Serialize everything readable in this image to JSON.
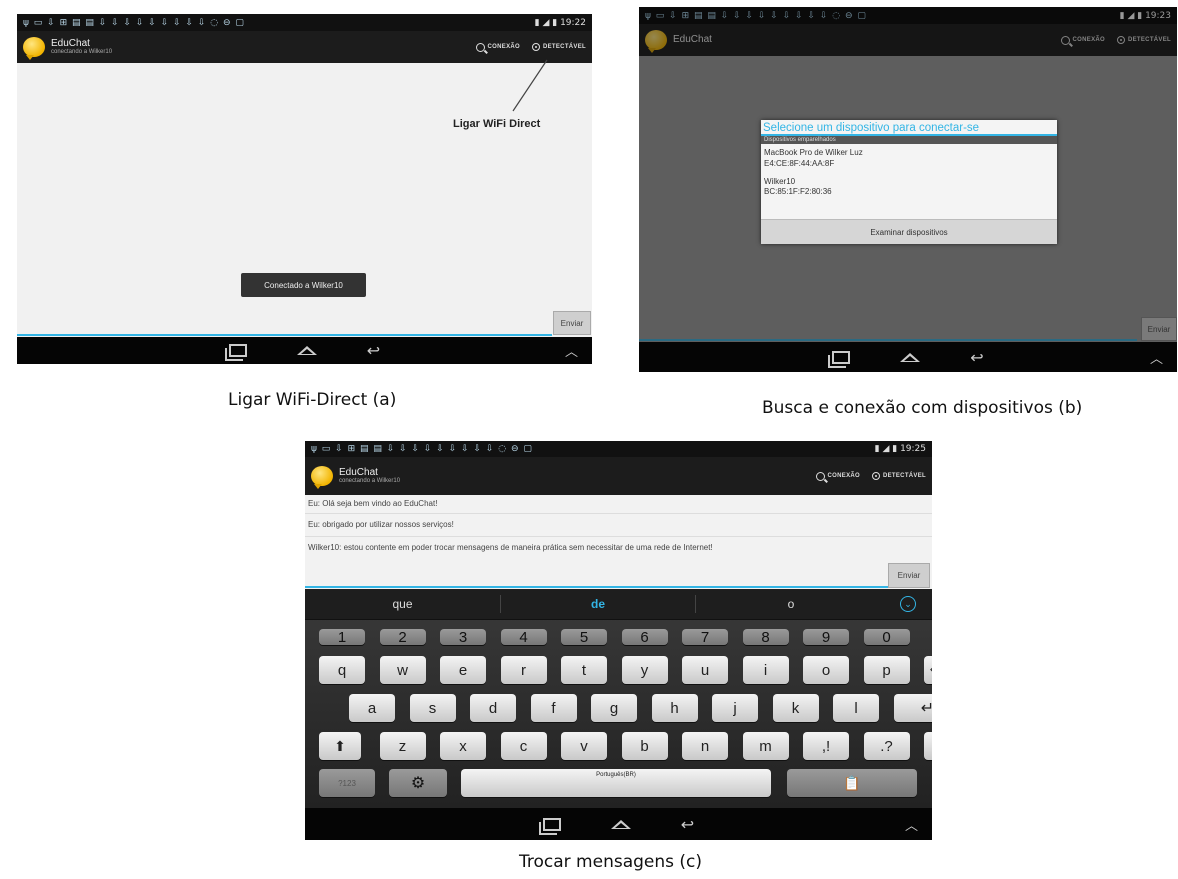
{
  "captions": {
    "a": "Ligar WiFi-Direct (a)",
    "b": "Busca e conexão com dispositivos (b)",
    "c": "Trocar mensagens (c)"
  },
  "colors": {
    "accent": "#33b5e5",
    "actionbar": "#1c1c1c",
    "navbar": "#050505"
  },
  "app": {
    "title": "EduChat",
    "subtitle": "conectando a Wilker10",
    "actions": {
      "connect": "CONEXÃO",
      "discoverable": "DETECTÁVEL"
    },
    "send_label": "Enviar"
  },
  "screen_a": {
    "status_time": "19:22",
    "annotation": "Ligar WiFi Direct",
    "toast": "Conectado a Wilker10"
  },
  "screen_b": {
    "status_time": "19:23",
    "dialog": {
      "title": "Selecione um dispositivo para conectar-se",
      "section": "Dispositivos emparelhados",
      "devices": [
        {
          "name": "MacBook Pro de Wilker Luz",
          "address": "E4:CE:8F:44:AA:8F"
        },
        {
          "name": "Wilker10",
          "address": "BC:85:1F:F2:80:36"
        }
      ],
      "scan_button": "Examinar dispositivos"
    }
  },
  "screen_c": {
    "status_time": "19:25",
    "messages": [
      "Eu:  Olá seja bem vindo ao EduChat!",
      "Eu:  obrigado por utilizar nossos serviços!",
      "Wilker10:  estou contente em poder trocar mensagens de maneira prática sem necessitar de uma rede de Internet!"
    ],
    "suggestions": [
      "que",
      "de",
      "o"
    ],
    "keyboard": {
      "row1": [
        "1",
        "2",
        "3",
        "4",
        "5",
        "6",
        "7",
        "8",
        "9",
        "0"
      ],
      "row2": [
        "q",
        "w",
        "e",
        "r",
        "t",
        "y",
        "u",
        "i",
        "o",
        "p"
      ],
      "row3": [
        "a",
        "s",
        "d",
        "f",
        "g",
        "h",
        "j",
        "k",
        "l"
      ],
      "row4": [
        "z",
        "x",
        "c",
        "v",
        "b",
        "n",
        "m",
        ",!",
        ".?"
      ],
      "mode_key": "?123",
      "space_label": "Português(BR)"
    }
  }
}
